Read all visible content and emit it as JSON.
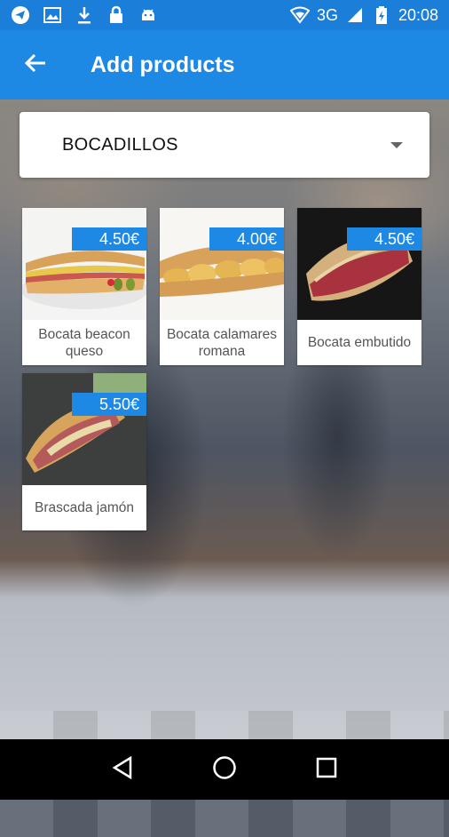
{
  "status_bar": {
    "left_icons": [
      "telegram-icon",
      "image-icon",
      "download-icon",
      "lock-icon",
      "android-icon"
    ],
    "network": "3G",
    "time": "20:08"
  },
  "app_bar": {
    "title": "Add products",
    "back_icon": "arrow-back-icon"
  },
  "category_dropdown": {
    "selected": "BOCADILLOS"
  },
  "products": [
    {
      "name": "Bocata beacon queso",
      "price": "4.50€"
    },
    {
      "name": "Bocata calamares romana",
      "price": "4.00€"
    },
    {
      "name": "Bocata embutido",
      "price": "4.50€"
    },
    {
      "name": "Brascada jamón",
      "price": "5.50€"
    }
  ],
  "colors": {
    "primary": "#1e88e5",
    "status_bar": "#1b7ed8",
    "price_badge": "#1e88e5"
  },
  "nav_bar": [
    "back-triangle-icon",
    "home-circle-icon",
    "recents-square-icon"
  ]
}
